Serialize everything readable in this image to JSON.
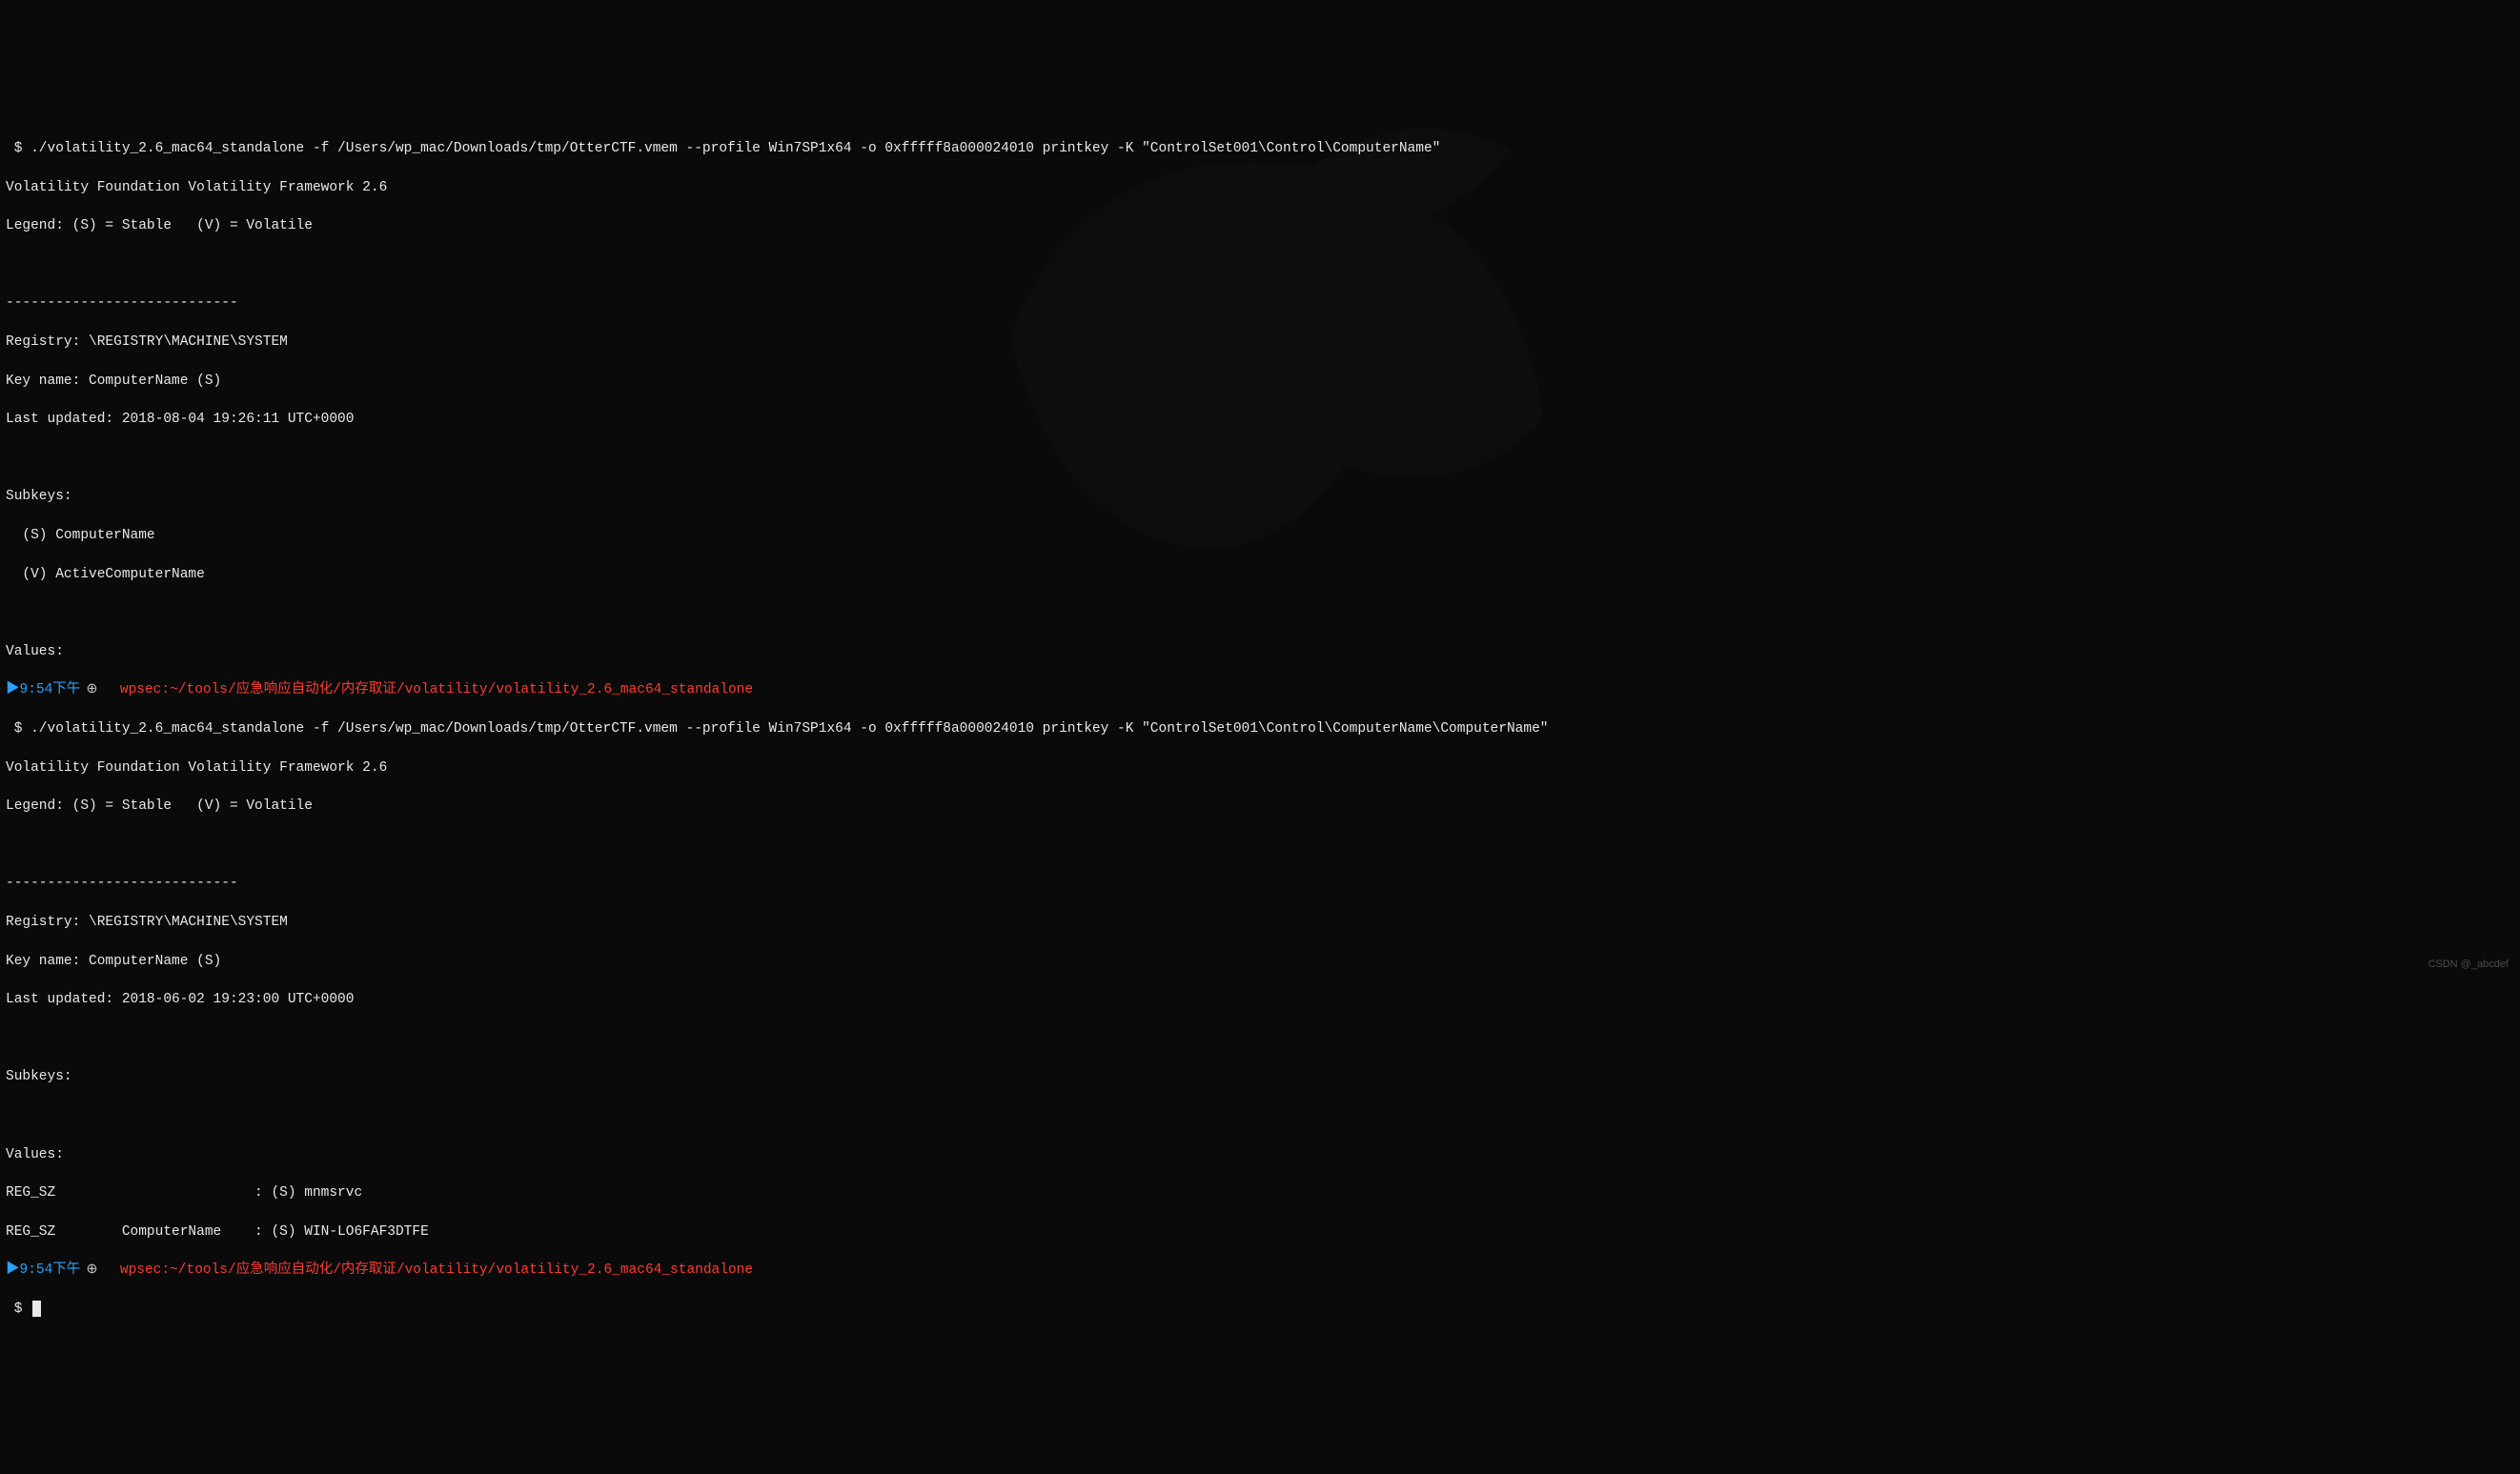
{
  "block1": {
    "prompt_dollar": " $ ",
    "command": "./volatility_2.6_mac64_standalone -f /Users/wp_mac/Downloads/tmp/OtterCTF.vmem --profile Win7SP1x64 -o 0xfffff8a000024010 printkey -K \"ControlSet001\\Control\\ComputerName\"",
    "framework": "Volatility Foundation Volatility Framework 2.6",
    "legend": "Legend: (S) = Stable   (V) = Volatile",
    "sep": "----------------------------",
    "registry": "Registry: \\REGISTRY\\MACHINE\\SYSTEM",
    "keyname": "Key name: ComputerName (S)",
    "lastupdated": "Last updated: 2018-08-04 19:26:11 UTC+0000",
    "subkeys_header": "Subkeys:",
    "subkey1": "  (S) ComputerName",
    "subkey2": "  (V) ActiveComputerName",
    "values_header": "Values:"
  },
  "prompt1": {
    "arrow": "▶",
    "time": "9:54下午",
    "clock": "⊕",
    "user": "wpsec:",
    "path": "~/tools/应急响应自动化/内存取证/volatility/volatility_2.6_mac64_standalone"
  },
  "block2": {
    "prompt_dollar": " $ ",
    "command": "./volatility_2.6_mac64_standalone -f /Users/wp_mac/Downloads/tmp/OtterCTF.vmem --profile Win7SP1x64 -o 0xfffff8a000024010 printkey -K \"ControlSet001\\Control\\ComputerName\\ComputerName\"",
    "framework": "Volatility Foundation Volatility Framework 2.6",
    "legend": "Legend: (S) = Stable   (V) = Volatile",
    "sep": "----------------------------",
    "registry": "Registry: \\REGISTRY\\MACHINE\\SYSTEM",
    "keyname": "Key name: ComputerName (S)",
    "lastupdated": "Last updated: 2018-06-02 19:23:00 UTC+0000",
    "subkeys_header": "Subkeys:",
    "values_header": "Values:",
    "value1": "REG_SZ                        : (S) mnmsrvc",
    "value2": "REG_SZ        ComputerName    : (S) WIN-LO6FAF3DTFE"
  },
  "prompt2": {
    "arrow": "▶",
    "time": "9:54下午",
    "clock": "⊕",
    "user": "wpsec:",
    "path": "~/tools/应急响应自动化/内存取证/volatility/volatility_2.6_mac64_standalone"
  },
  "prompt3": {
    "dollar": " $ "
  },
  "watermark": "CSDN @_abcdef"
}
